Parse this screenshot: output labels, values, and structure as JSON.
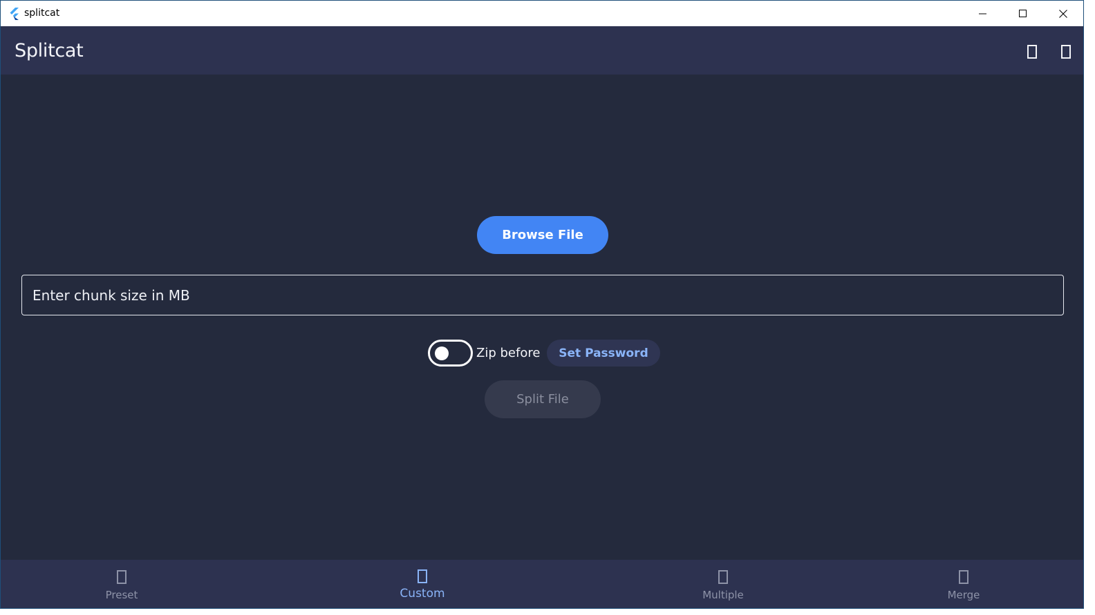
{
  "window": {
    "title": "splitcat",
    "controls": {
      "minimize": "minimize-icon",
      "maximize": "maximize-icon",
      "close": "close-icon"
    }
  },
  "appbar": {
    "title": "Splitcat",
    "actions": [
      {
        "icon": "missing-glyph-icon"
      },
      {
        "icon": "missing-glyph-icon"
      }
    ]
  },
  "main": {
    "browse_label": "Browse File",
    "chunk_input": {
      "placeholder": "Enter chunk size in MB",
      "value": ""
    },
    "zip_toggle": {
      "label": "Zip before",
      "checked": false
    },
    "set_password_label": "Set Password",
    "split_label": "Split File"
  },
  "bottom_nav": {
    "items": [
      {
        "label": "Preset",
        "icon": "missing-glyph-icon",
        "active": false
      },
      {
        "label": "Custom",
        "icon": "missing-glyph-icon",
        "active": true
      },
      {
        "label": "Multiple",
        "icon": "missing-glyph-icon",
        "active": false
      },
      {
        "label": "Merge",
        "icon": "missing-glyph-icon",
        "active": false
      }
    ]
  },
  "colors": {
    "background": "#242a3d",
    "appbar": "#2d3250",
    "accent": "#4285f4",
    "active_nav": "#8ab4f8",
    "inactive_nav": "#8e93a8"
  }
}
